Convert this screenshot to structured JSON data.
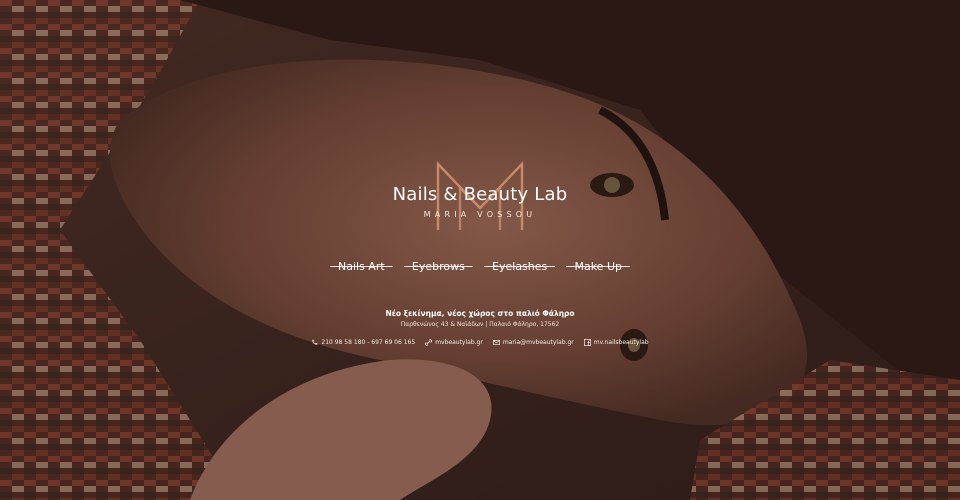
{
  "logo": {
    "title": "Nails & Beauty Lab",
    "subtitle": "MARIA VOSSOU",
    "monogram": "M",
    "accent_color": "#c98a6a"
  },
  "nav": [
    {
      "label": "Nails Art"
    },
    {
      "label": "Eyebrows"
    },
    {
      "label": "Eyelashes"
    },
    {
      "label": "Make Up"
    }
  ],
  "info": {
    "tagline": "Νέο ξεκίνημα, νέος χώρος στο παλιό Φάληρο",
    "address": "Παρθενώνος 43 & Ναϊάδων | Παλαιό Φάληρο, 17562"
  },
  "contacts": {
    "phone": {
      "icon": "phone-icon",
      "text": "210 98 58 180 - 697 69 06 165"
    },
    "website": {
      "icon": "link-icon",
      "text": "mvbeautylab.gr"
    },
    "email": {
      "icon": "mail-icon",
      "text": "maria@mvbeautylab.gr"
    },
    "facebook": {
      "icon": "facebook-icon",
      "text": "mv.nailsbeautylab"
    }
  }
}
